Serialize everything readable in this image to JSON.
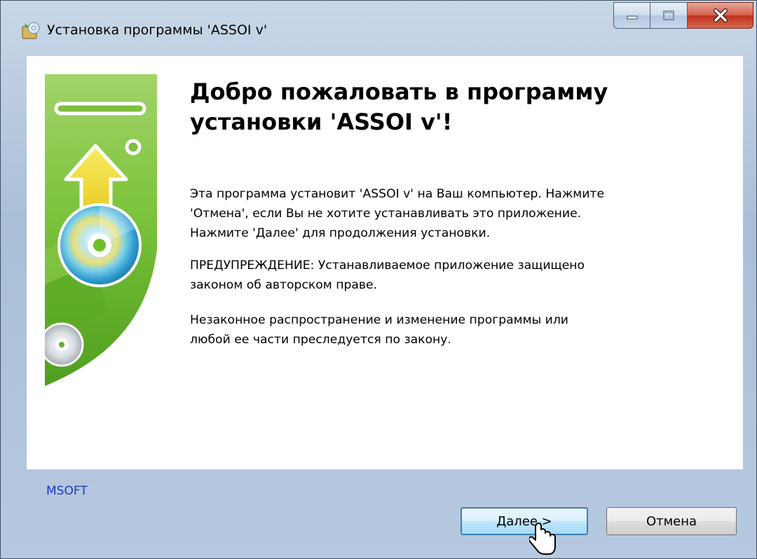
{
  "window": {
    "title": "Установка программы 'ASSOI v'"
  },
  "welcome": {
    "title": "Добро пожаловать в программу установки 'ASSOI v'!",
    "paragraph1": "Эта программа установит 'ASSOI v' на Ваш компьютер. Нажмите\n'Отмена', если Вы не хотите устанавливать это приложение.\nНажмите 'Далее' для продолжения установки.",
    "paragraph2": "ПРЕДУПРЕЖДЕНИЕ: Устанавливаемое приложение защищено\nзаконом об авторском праве.",
    "paragraph3": "Незаконное распространение и изменение программы или\nлюбой ее части преследуется по закону."
  },
  "footer": {
    "brand": "MSOFT",
    "next_label": "Далее >",
    "cancel_label": "Отмена"
  },
  "colors": {
    "brand_text": "#1e35c8",
    "hero_green": "#6fbf2a",
    "arrow_yellow": "#f3e32a",
    "close_red": "#c0301b"
  },
  "icons": {
    "app": "installer-app-icon",
    "minimize": "minimize-icon",
    "maximize": "maximize-icon",
    "close": "close-icon",
    "hero": "install-cd-illustration",
    "cursor": "mouse-pointer-icon"
  }
}
